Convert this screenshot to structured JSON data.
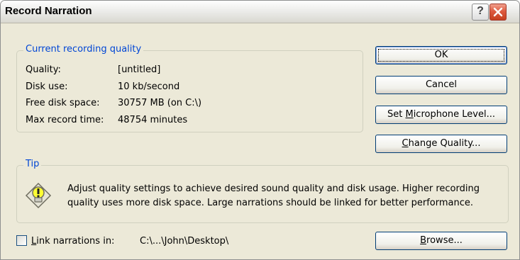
{
  "window": {
    "title": "Record Narration"
  },
  "titlebar": {
    "help_symbol": "?",
    "close_icon": "close-x-icon"
  },
  "quality_group": {
    "legend": "Current recording quality",
    "rows": [
      {
        "label": "Quality:",
        "value": "[untitled]"
      },
      {
        "label": "Disk use:",
        "value": "10 kb/second"
      },
      {
        "label": "Free disk space:",
        "value": "30757 MB (on C:\\)"
      },
      {
        "label": "Max record time:",
        "value": "48754 minutes"
      }
    ]
  },
  "buttons": {
    "ok": "OK",
    "cancel": "Cancel",
    "mic_pre": "Set ",
    "mic_u": "M",
    "mic_post": "icrophone Level...",
    "quality_u": "C",
    "quality_post": "hange Quality...",
    "browse_u": "B",
    "browse_post": "rowse..."
  },
  "tip_group": {
    "legend": "Tip",
    "icon": "lightbulb-tip-icon",
    "text": "Adjust quality settings to achieve desired sound quality and disk usage. Higher recording quality uses more disk space. Large narrations should be linked for better performance."
  },
  "link": {
    "label_u": "L",
    "label_post": "ink narrations in:",
    "checked": false,
    "path": "C:\\...\\John\\Desktop\\"
  },
  "colors": {
    "accent": "#0046d5",
    "dialog_bg": "#ece9d8",
    "close_red": "#dd5a3f"
  }
}
